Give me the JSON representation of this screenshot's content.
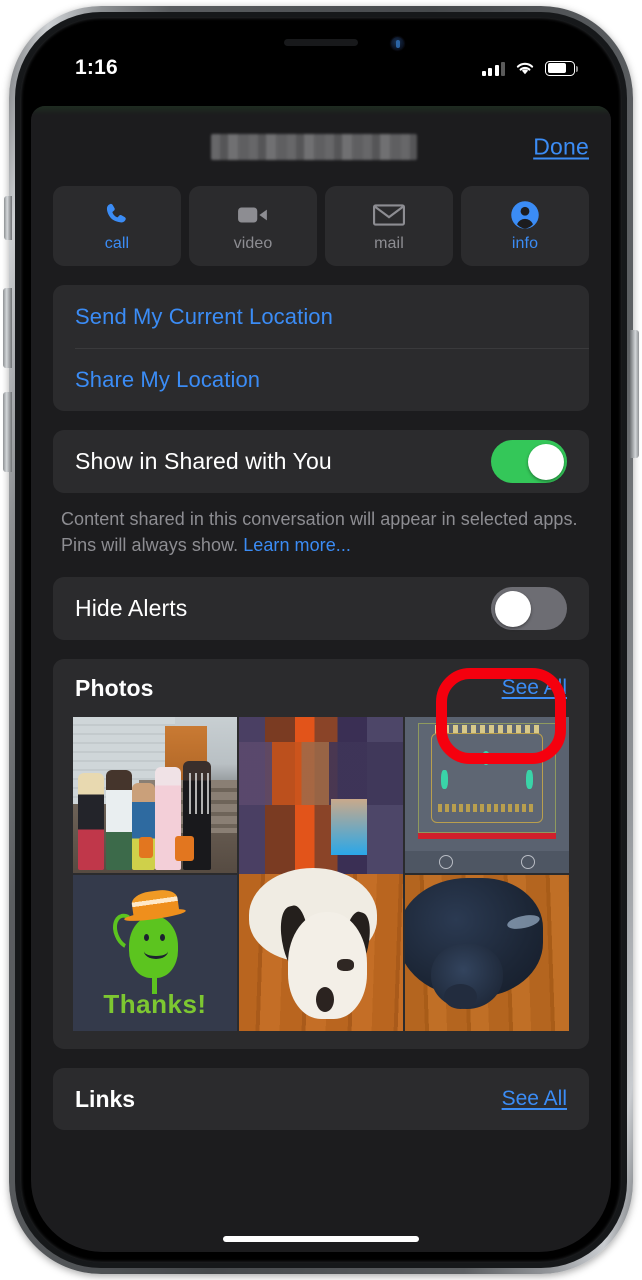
{
  "status_bar": {
    "time": "1:16",
    "cellular_icon": "cellular-bars-icon",
    "cellular_bars_filled": 3,
    "cellular_bars_total": 4,
    "wifi_icon": "wifi-icon",
    "battery_icon": "battery-icon",
    "battery_level_percent": 75
  },
  "sheet": {
    "contact_name": "",
    "contact_name_redacted": true,
    "done_label": "Done"
  },
  "actions": [
    {
      "label": "call",
      "icon": "phone-icon",
      "enabled": true
    },
    {
      "label": "video",
      "icon": "video-camera-icon",
      "enabled": false
    },
    {
      "label": "mail",
      "icon": "envelope-icon",
      "enabled": false
    },
    {
      "label": "info",
      "icon": "person-circle-icon",
      "enabled": true
    }
  ],
  "location": {
    "send_current": "Send My Current Location",
    "share": "Share My Location"
  },
  "shared_with_you": {
    "label": "Show in Shared with You",
    "toggle_state": "on",
    "toggle_color": "#34c759",
    "footnote_text": "Content shared in this conversation will appear in selected apps. Pins will always show. ",
    "footnote_link": "Learn more..."
  },
  "hide_alerts": {
    "label": "Hide Alerts",
    "toggle_state": "off",
    "toggle_color": "#6d6d73"
  },
  "photos": {
    "title": "Photos",
    "see_all_label": "See All",
    "annotated": true,
    "annotation_color": "#f5000e",
    "items": [
      {
        "name": "halloween-kids-on-porch"
      },
      {
        "name": "pixelated-person-and-sleeping-puppy"
      },
      {
        "name": "decorative-ticket-screenshot"
      },
      {
        "name": "thanks-bean-sticker",
        "caption": "Thanks!"
      },
      {
        "name": "black-puppy-on-wood-floor"
      }
    ]
  },
  "links": {
    "title": "Links",
    "see_all_label": "See All"
  },
  "colors": {
    "accent_blue": "#3b8cf5",
    "sheet_bg": "#1c1c1e",
    "card_bg": "#2b2b2d",
    "secondary_text": "#8d8d92"
  }
}
